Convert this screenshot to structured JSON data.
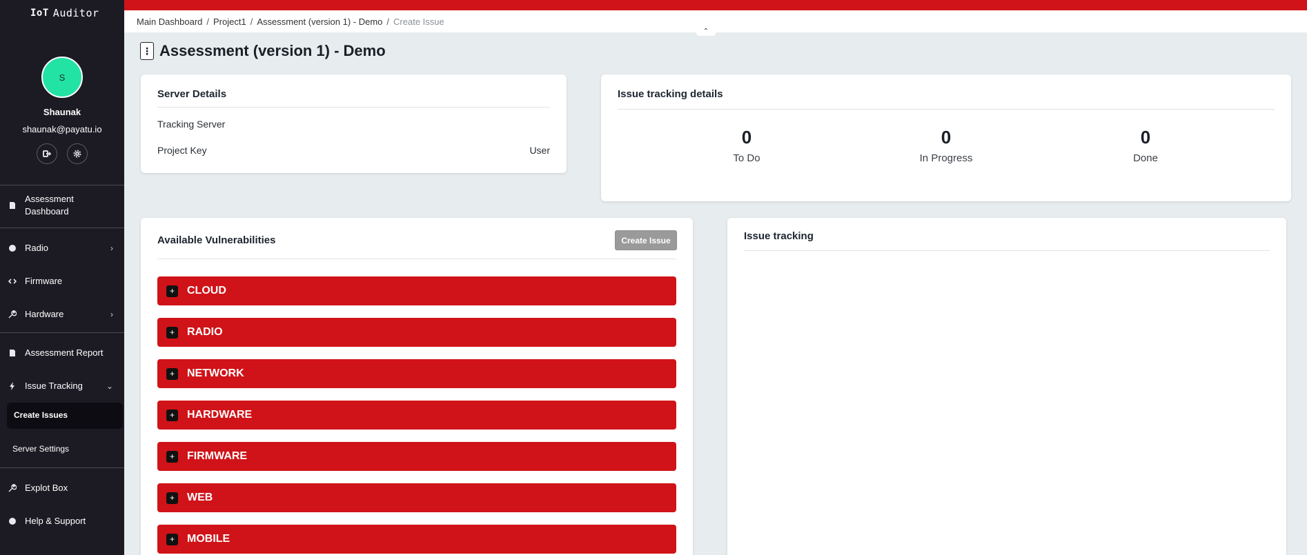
{
  "app": {
    "name": "Auditor",
    "logo_mark": "IoT"
  },
  "user": {
    "initial": "S",
    "name": "Shaunak",
    "email": "shaunak@payatu.io",
    "actions": [
      "logout-icon",
      "settings-icon"
    ]
  },
  "sidebar": {
    "items": [
      {
        "label": "Assessment Dashboard",
        "icon": "document-icon"
      },
      {
        "label": "Radio",
        "icon": "bluetooth-icon",
        "chevron": "›"
      },
      {
        "label": "Firmware",
        "icon": "code-icon"
      },
      {
        "label": "Hardware",
        "icon": "wrench-icon",
        "chevron": "›"
      },
      {
        "label": "Assessment Report",
        "icon": "report-icon"
      },
      {
        "label": "Issue Tracking",
        "icon": "bolt-icon",
        "chevron": "⌄"
      },
      {
        "label": "Explot Box",
        "icon": "wrench-icon"
      },
      {
        "label": "Help & Support",
        "icon": "globe-icon"
      }
    ],
    "sub_items": [
      "Create Issues",
      "Server Settings"
    ]
  },
  "breadcrumb": [
    "Main Dashboard",
    "Project1",
    "Assessment (version 1) - Demo",
    "Create Issue"
  ],
  "breadcrumb_sep": "/",
  "collapse_glyph": "⌃",
  "page": {
    "title": "Assessment (version 1) - Demo",
    "menu_glyph": "⋮"
  },
  "server_details": {
    "title": "Server Details",
    "tracking_server_label": "Tracking Server",
    "tracking_server_value": "",
    "project_key_label": "Project Key",
    "project_key_value": "User"
  },
  "issue_tracking_details": {
    "title": "Issue tracking details",
    "stats": [
      {
        "value": "0",
        "label": "To Do"
      },
      {
        "value": "0",
        "label": "In Progress"
      },
      {
        "value": "0",
        "label": "Done"
      }
    ]
  },
  "vulnerabilities": {
    "title": "Available Vulnerabilities",
    "create_button": "Create Issue",
    "categories": [
      "CLOUD",
      "RADIO",
      "NETWORK",
      "HARDWARE",
      "FIRMWARE",
      "WEB",
      "MOBILE"
    ],
    "expand_glyph": "+"
  },
  "issue_tracking": {
    "title": "Issue tracking"
  },
  "colors": {
    "accent": "#d01318",
    "sidebar_bg": "#1c1b24",
    "avatar_bg": "#22e3a4",
    "page_bg": "#e7ecee"
  }
}
